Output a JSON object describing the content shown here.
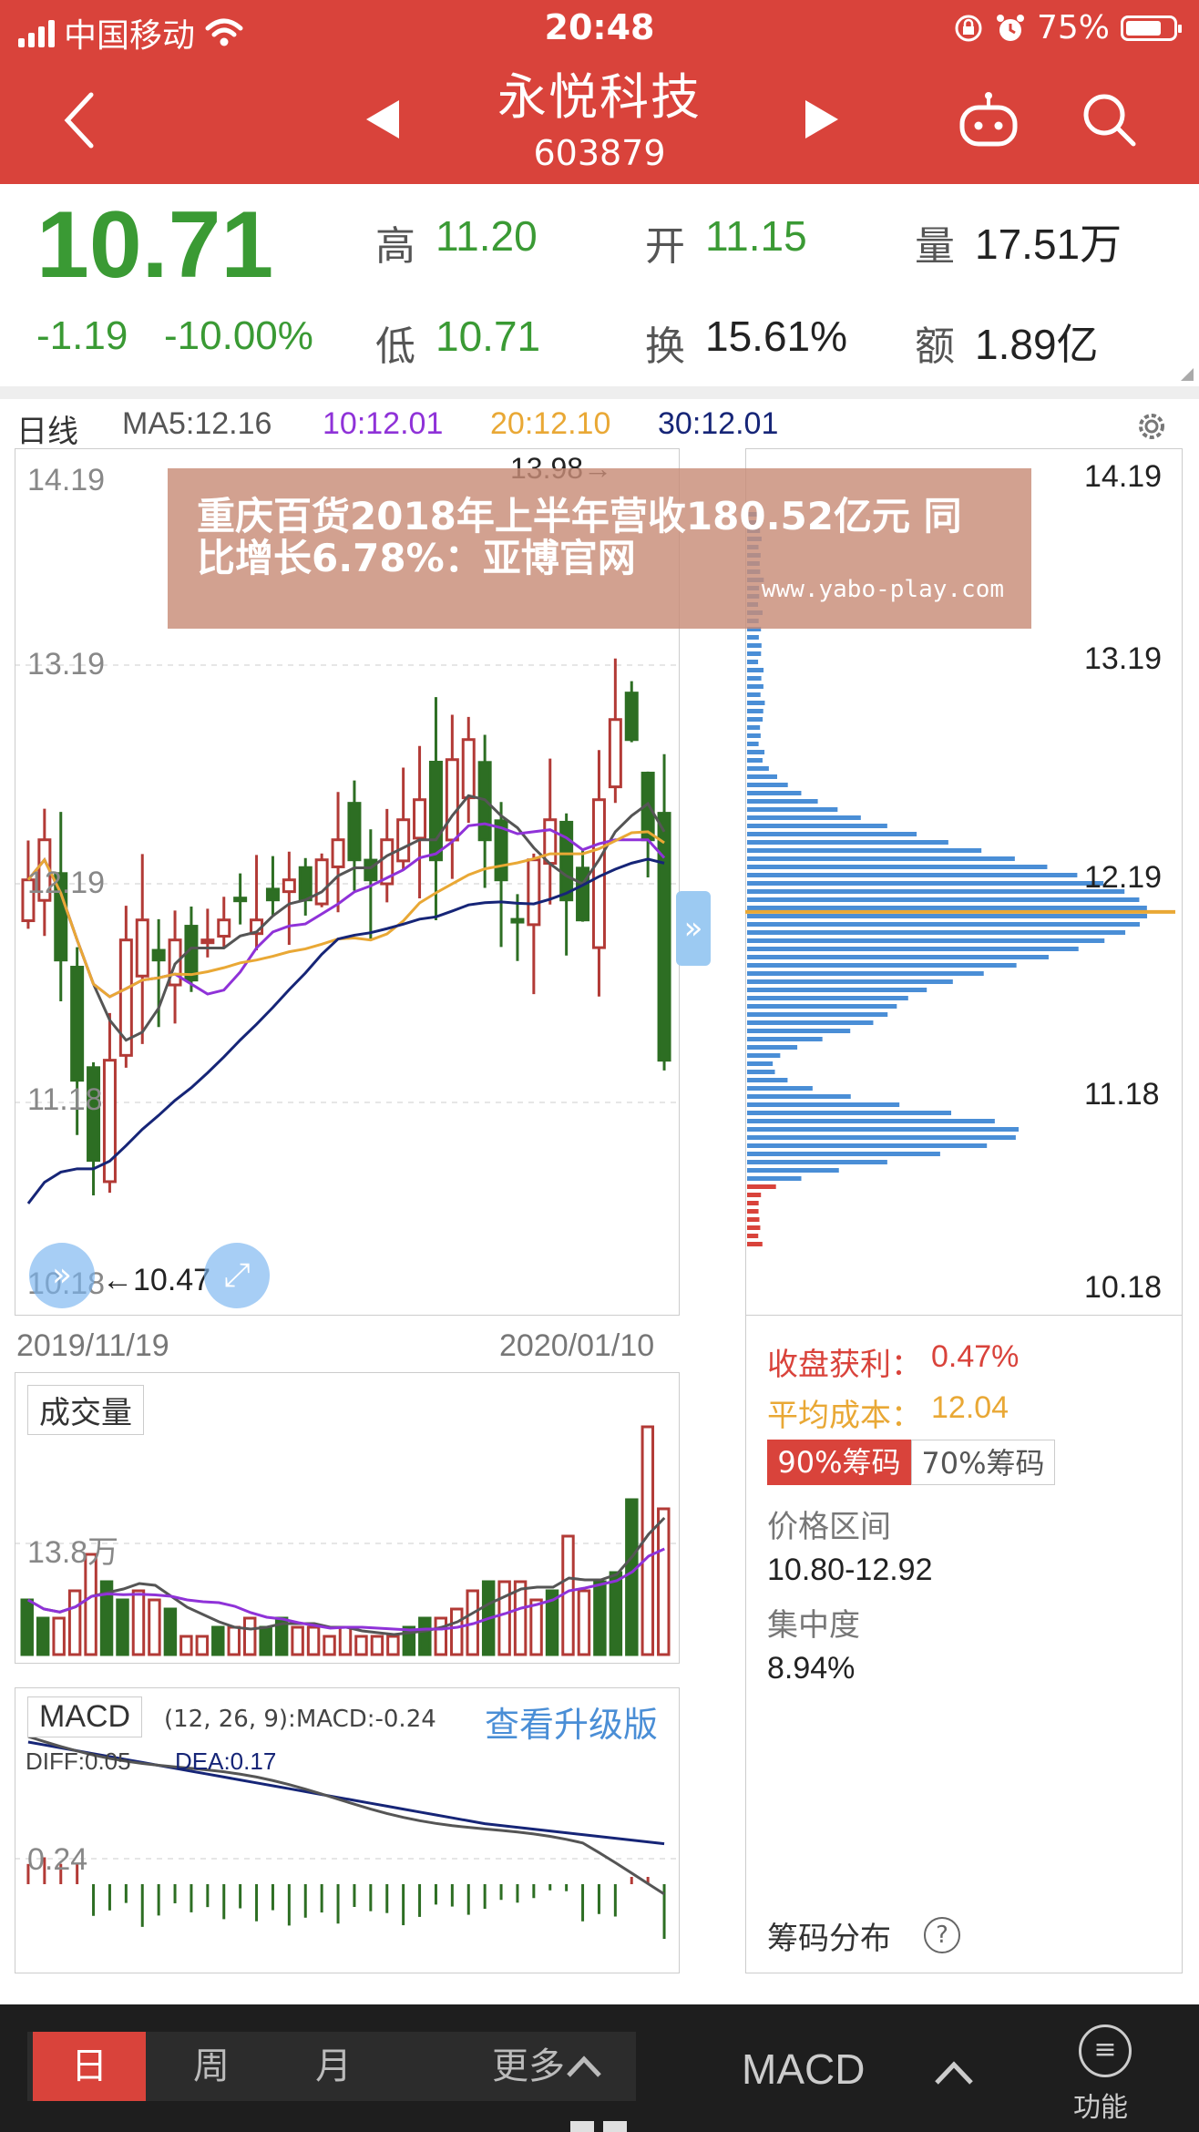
{
  "status": {
    "carrier": "中国移动",
    "time": "20:48",
    "battery": "75%",
    "battery_level": 0.75
  },
  "header": {
    "name": "永悦科技",
    "code": "603879"
  },
  "quote": {
    "price": "10.71",
    "change": "-1.19",
    "change_pct": "-10.00%",
    "high_label": "高",
    "high": "11.20",
    "open_label": "开",
    "open": "11.15",
    "volume_label": "量",
    "volume": "17.51万",
    "low_label": "低",
    "low": "10.71",
    "turnover_label": "换",
    "turnover": "15.61%",
    "amount_label": "额",
    "amount": "1.89亿"
  },
  "kline": {
    "period": "日线",
    "ma5": "MA5:12.16",
    "ma10": "10:12.01",
    "ma20": "20:12.10",
    "ma30": "30:12.01",
    "price_labels": [
      "14.19",
      "13.19",
      "12.19",
      "11.18",
      "10.18"
    ],
    "high_marker": "13.98→",
    "low_marker": "←10.47",
    "date_start": "2019/11/19",
    "date_end": "2020/01/10",
    "colors": {
      "up": "#b23a36",
      "down": "#2d6e23",
      "ma5": "#555555",
      "ma10": "#8f32d8",
      "ma20": "#e9a835",
      "ma30": "#162577"
    }
  },
  "banner": {
    "title": "重庆百货2018年上半年营收180.52亿元 同比增长6.78%：亚博官网",
    "url": "www.yabo-play.com"
  },
  "volume_panel": {
    "title": "成交量",
    "label": "13.8万"
  },
  "macd_panel": {
    "title": "MACD",
    "params": "(12, 26, 9):MACD:-0.24",
    "upgrade": "查看升级版",
    "diff": "DIFF:0.05",
    "dea": "DEA:0.17",
    "label": "0.24"
  },
  "chips": {
    "profit_label": "收盘获利：",
    "profit": "0.47%",
    "avg_cost_label": "平均成本：",
    "avg_cost": "12.04",
    "tab_90": "90%筹码",
    "tab_70": "70%筹码",
    "range_label": "价格区间",
    "range": "10.80-12.92",
    "concentration_label": "集中度",
    "concentration": "8.94%",
    "footer": "筹码分布",
    "help": "?"
  },
  "bottom_nav": {
    "day": "日",
    "week": "周",
    "month": "月",
    "more": "更多",
    "indicator": "MACD",
    "function": "功能"
  }
}
